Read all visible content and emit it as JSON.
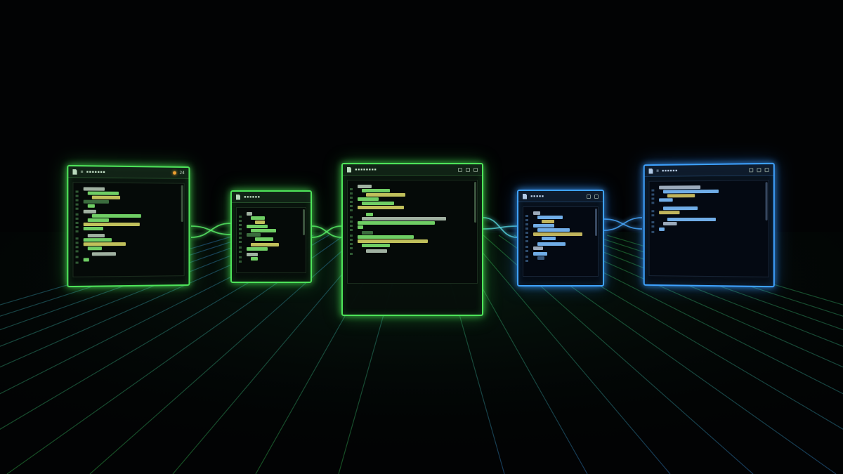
{
  "scene": {
    "background": "#020304",
    "grid_color_green": "#1d6a34",
    "grid_color_blue": "#1d4f7a",
    "green_accent": "#4ee45a",
    "blue_accent": "#3ea2ff"
  },
  "windows": [
    {
      "id": "w1",
      "theme": "green",
      "title": "≡ ▪▪▪▪▪▪▪",
      "extra": "24",
      "icons": [
        "file-icon",
        "status-dot",
        "counter"
      ]
    },
    {
      "id": "w2",
      "theme": "green",
      "title": "▪▪▪▪▪▪",
      "icons": [
        "file-icon"
      ]
    },
    {
      "id": "w3",
      "theme": "green",
      "title": "▪▪▪▪▪▪▪▪",
      "icons": [
        "file-icon",
        "settings-icon",
        "window-icon",
        "close-icon"
      ]
    },
    {
      "id": "w4",
      "theme": "blue",
      "title": "▪▪▪▪▪",
      "icons": [
        "file-icon",
        "window-icon",
        "flag-icon"
      ]
    },
    {
      "id": "w5",
      "theme": "blue",
      "title": "≡ ▪▪▪▪▪▪",
      "icons": [
        "file-icon",
        "window-icon",
        "settings-icon",
        "close-icon"
      ]
    }
  ]
}
